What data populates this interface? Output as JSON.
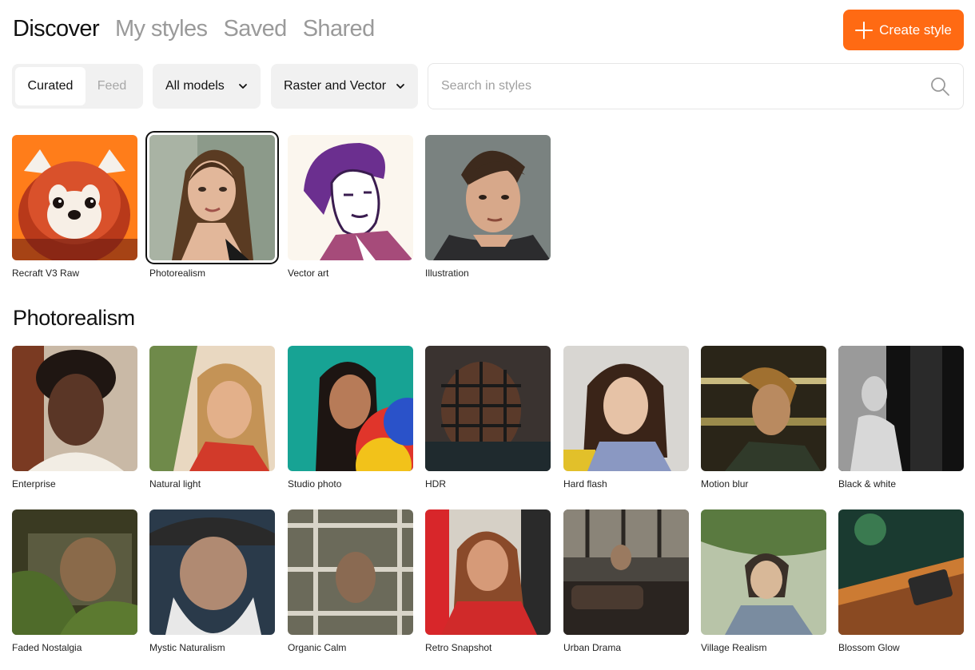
{
  "header": {
    "tabs": [
      {
        "label": "Discover",
        "active": true
      },
      {
        "label": "My styles",
        "active": false
      },
      {
        "label": "Saved",
        "active": false
      },
      {
        "label": "Shared",
        "active": false
      }
    ],
    "create_label": "Create style"
  },
  "filters": {
    "segment": {
      "curated": "Curated",
      "feed": "Feed",
      "selected": "Curated"
    },
    "models": "All models",
    "type": "Raster and Vector",
    "search_placeholder": "Search in styles"
  },
  "featured": [
    {
      "label": "Recraft V3 Raw",
      "icon": "red-panda-image"
    },
    {
      "label": "Photorealism",
      "icon": "woman-portrait-image",
      "selected": true
    },
    {
      "label": "Vector art",
      "icon": "vector-portrait-image"
    },
    {
      "label": "Illustration",
      "icon": "man-illustration-image"
    }
  ],
  "section": {
    "title": "Photorealism",
    "rows": [
      [
        {
          "label": "Enterprise"
        },
        {
          "label": "Natural light"
        },
        {
          "label": "Studio photo"
        },
        {
          "label": "HDR"
        },
        {
          "label": "Hard flash"
        },
        {
          "label": "Motion blur"
        },
        {
          "label": "Black & white"
        }
      ],
      [
        {
          "label": "Faded Nostalgia"
        },
        {
          "label": "Mystic Naturalism"
        },
        {
          "label": "Organic Calm"
        },
        {
          "label": "Retro Snapshot"
        },
        {
          "label": "Urban Drama"
        },
        {
          "label": "Village Realism"
        },
        {
          "label": "Blossom Glow"
        }
      ]
    ]
  },
  "colors": {
    "accent": "#ff6a13"
  }
}
